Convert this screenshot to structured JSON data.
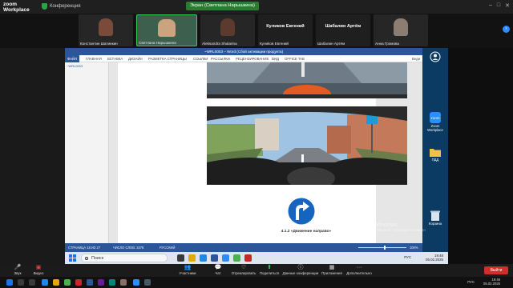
{
  "zoom": {
    "app_name_line1": "zoom",
    "app_name_line2": "Workplace",
    "meeting_label": "Конференция",
    "share_label": "Экран (Светлана Нарышкина)",
    "window_controls": [
      "–",
      "□",
      "✕"
    ],
    "participants": [
      {
        "name": "Константин Шатинкин",
        "avatar_color": "#7a4a3a"
      },
      {
        "name": "Светлана Нарышкина",
        "avatar_color": "#caa37f"
      },
      {
        "name": "Aleksandra Shalarina",
        "avatar_color": "#5c3b2e"
      },
      {
        "name": "Кулиkов Евгений",
        "big_name": "Куликов Евгений"
      },
      {
        "name": "Шабалин Артём",
        "big_name": "Шабалин Артём"
      },
      {
        "name": "Анна Громова",
        "avatar_color": "#8c7d72"
      }
    ],
    "bottom_controls": [
      {
        "label": "Звук",
        "icon": "audio-icon"
      },
      {
        "label": "Видео",
        "icon": "video-icon"
      },
      {
        "label": "Участники",
        "icon": "participants-icon",
        "count": "52"
      },
      {
        "label": "Чат",
        "icon": "chat-icon"
      },
      {
        "label": "Отреагировать",
        "icon": "react-icon"
      },
      {
        "label": "Поделиться",
        "icon": "share-icon"
      },
      {
        "label": "Данные конференции",
        "icon": "info-icon"
      },
      {
        "label": "Приложения",
        "icon": "apps-icon"
      },
      {
        "label": "Дополнительно",
        "icon": "more-icon"
      }
    ],
    "end_label": "Выйти"
  },
  "word": {
    "title": "~WRL0003 – Word (Сбой активации продукта)",
    "tabs": [
      "ФАЙЛ",
      "ГЛАВНАЯ",
      "ВСТАВКА",
      "ДИЗАЙН",
      "РАЗМЕТКА СТРАНИЦЫ",
      "ССЫЛКИ",
      "РАССЫЛКИ",
      "РЕЦЕНЗИРОВАНИЕ",
      "ВИД",
      "OFFICE TAB"
    ],
    "user": "Веди",
    "nav_tab": "~WRL0003",
    "status_page": "СТРАНИЦА 18 ИЗ 27",
    "status_words": "ЧИСЛО СЛОВ: 3378",
    "status_lang": "РУССКИЙ",
    "zoom_pct": "100%",
    "caption": "4.1.2 «Движение направо»"
  },
  "desktop": {
    "icons": [
      {
        "label": "Zoom Workplace",
        "icon": "zoom-app-icon"
      },
      {
        "label": "ПДД",
        "icon": "folder-icon"
      },
      {
        "label": "Корзина",
        "icon": "recycle-bin-icon"
      }
    ],
    "activation_title": "Активация Windows",
    "activation_sub": "Чтобы активировать Windows, перейдите в раздел \"Параметры\"."
  },
  "guest_taskbar": {
    "search_label": "Поиск",
    "lang": "РУС",
    "time": "19:48",
    "date": "05.02.2025"
  },
  "host_taskbar": {
    "lang": "РУС",
    "time": "19:48",
    "date": "05.02.2025"
  },
  "colors": {
    "word_blue": "#2b579a",
    "zoom_green": "#2d7a33",
    "sign_blue": "#1565c0"
  }
}
